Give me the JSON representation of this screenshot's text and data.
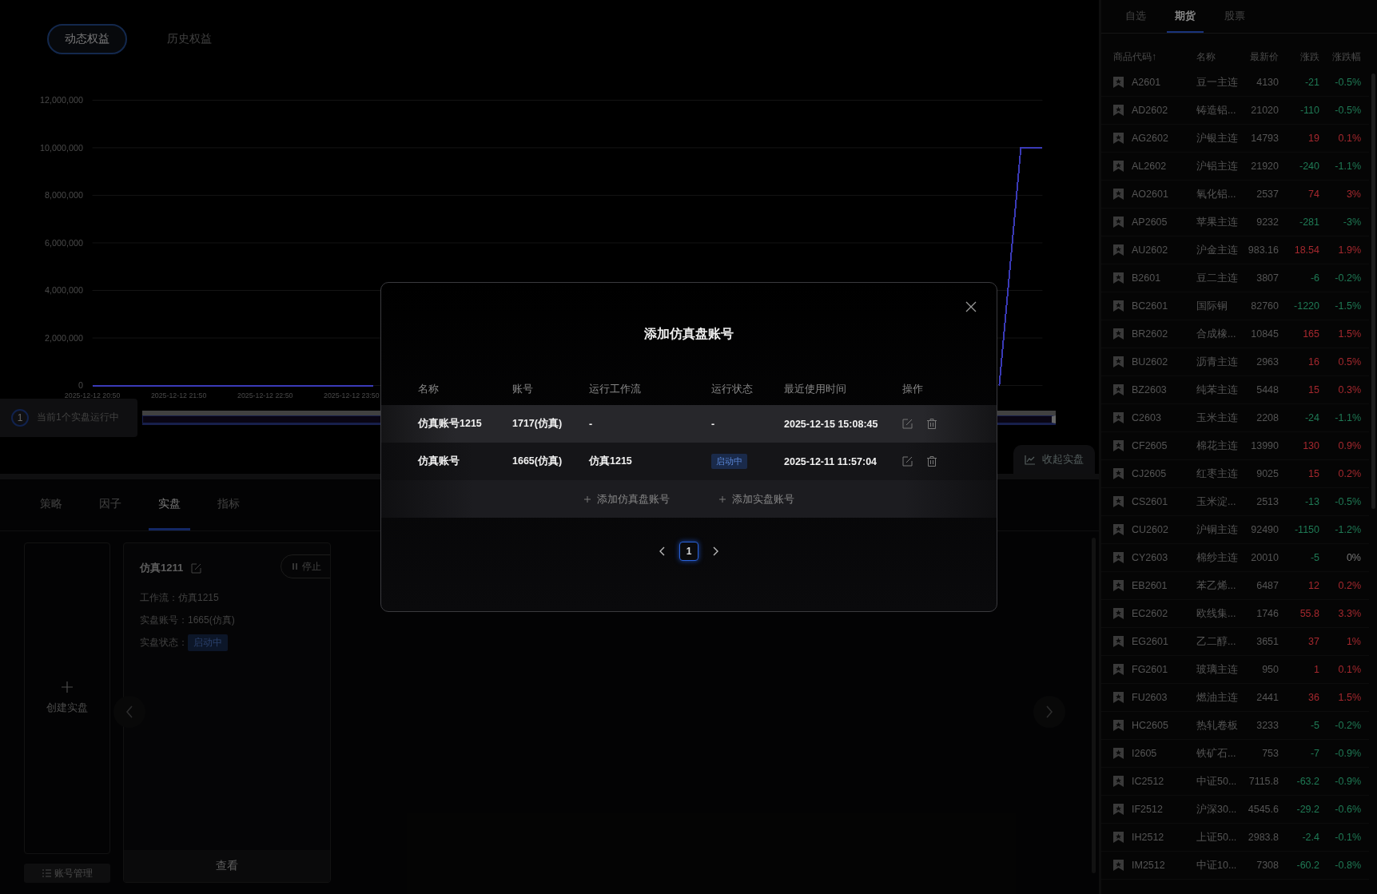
{
  "equity_tabs": [
    {
      "label": "动态权益",
      "selected": true
    },
    {
      "label": "历史权益",
      "selected": false
    }
  ],
  "chart": {
    "chart_data": {
      "type": "line",
      "grid": true,
      "categories": [
        "2025-12-12 20:50",
        null,
        null,
        null,
        "2025-12-12 21:50",
        null,
        null,
        null,
        "2025-12-12 22:50",
        null,
        null,
        null,
        "2025-12-12 23:50",
        null,
        null,
        null,
        null,
        null,
        null,
        null,
        null,
        null,
        null,
        null,
        null,
        null,
        null,
        null,
        null,
        null,
        null,
        null,
        null,
        null,
        null,
        null,
        null,
        null,
        null,
        null,
        null,
        null,
        null,
        null,
        null
      ],
      "series": [
        {
          "color": "#3a3ab8",
          "values": [
            0,
            0,
            0,
            0,
            0,
            0,
            0,
            0,
            0,
            0,
            0,
            0,
            0,
            0,
            null,
            null,
            null,
            null,
            null,
            null,
            null,
            null,
            null,
            null,
            null,
            null,
            null,
            null,
            null,
            null,
            null,
            null,
            null,
            null,
            null,
            null,
            null,
            null,
            null,
            null,
            null,
            null,
            0,
            10000000,
            10000000
          ]
        }
      ],
      "ylim": [
        0,
        12000000
      ],
      "yticks": [
        {
          "value": 0,
          "label": "0"
        },
        {
          "value": 2000000,
          "label": "2,000,000"
        },
        {
          "value": 4000000,
          "label": "4,000,000"
        },
        {
          "value": 6000000,
          "label": "6,000,000"
        },
        {
          "value": 8000000,
          "label": "8,000,000"
        },
        {
          "value": 10000000,
          "label": "10,000,000"
        },
        {
          "value": 12000000,
          "label": "12,000,000"
        }
      ]
    }
  },
  "running_notice": {
    "count": "1",
    "text": "当前1个实盘运行中"
  },
  "zoom_slider": {
    "level": 1
  },
  "collapse_button": "收起实盘",
  "section_tabs": [
    {
      "label": "策略",
      "selected": false
    },
    {
      "label": "因子",
      "selected": false
    },
    {
      "label": "实盘",
      "selected": true
    },
    {
      "label": "指标",
      "selected": false
    }
  ],
  "create_card": {
    "label": "创建实盘"
  },
  "account_manage_button": "账号管理",
  "live_card": {
    "title": "仿真1211",
    "stop_button": "停止",
    "fields": [
      {
        "label": "工作流：",
        "value": "仿真1215",
        "kind": "text"
      },
      {
        "label": "实盘账号：",
        "value": "1665(仿真)",
        "kind": "text"
      },
      {
        "label": "实盘状态：",
        "value": "启动中",
        "kind": "tag"
      }
    ],
    "footer_button": "查看"
  },
  "market": {
    "tabs": [
      {
        "label": "自选",
        "selected": false
      },
      {
        "label": "期货",
        "selected": true
      },
      {
        "label": "股票",
        "selected": false
      }
    ],
    "columns": [
      "商品代码↑",
      "名称",
      "最新价",
      "涨跌",
      "涨跌幅"
    ],
    "rows": [
      {
        "code": "A2601",
        "name": "豆一主连",
        "price": "4130",
        "change": {
          "text": "-21",
          "color": "#1f7a55"
        },
        "pct": {
          "text": "-0.5%",
          "color": "#1f7a55"
        }
      },
      {
        "code": "AD2602",
        "name": "铸造铝...",
        "price": "21020",
        "change": {
          "text": "-110",
          "color": "#1f7a55"
        },
        "pct": {
          "text": "-0.5%",
          "color": "#1f7a55"
        }
      },
      {
        "code": "AG2602",
        "name": "沪银主连",
        "price": "14793",
        "change": {
          "text": "19",
          "color": "#a5282e"
        },
        "pct": {
          "text": "0.1%",
          "color": "#a5282e"
        }
      },
      {
        "code": "AL2602",
        "name": "沪铝主连",
        "price": "21920",
        "change": {
          "text": "-240",
          "color": "#1f7a55"
        },
        "pct": {
          "text": "-1.1%",
          "color": "#1f7a55"
        }
      },
      {
        "code": "AO2601",
        "name": "氧化铝...",
        "price": "2537",
        "change": {
          "text": "74",
          "color": "#a5282e"
        },
        "pct": {
          "text": "3%",
          "color": "#a5282e"
        }
      },
      {
        "code": "AP2605",
        "name": "苹果主连",
        "price": "9232",
        "change": {
          "text": "-281",
          "color": "#1f7a55"
        },
        "pct": {
          "text": "-3%",
          "color": "#1f7a55"
        }
      },
      {
        "code": "AU2602",
        "name": "沪金主连",
        "price": "983.16",
        "change": {
          "text": "18.54",
          "color": "#a5282e"
        },
        "pct": {
          "text": "1.9%",
          "color": "#a5282e"
        }
      },
      {
        "code": "B2601",
        "name": "豆二主连",
        "price": "3807",
        "change": {
          "text": "-6",
          "color": "#1f7a55"
        },
        "pct": {
          "text": "-0.2%",
          "color": "#1f7a55"
        }
      },
      {
        "code": "BC2601",
        "name": "国际铜",
        "price": "82760",
        "change": {
          "text": "-1220",
          "color": "#1f7a55"
        },
        "pct": {
          "text": "-1.5%",
          "color": "#1f7a55"
        }
      },
      {
        "code": "BR2602",
        "name": "合成橡...",
        "price": "10845",
        "change": {
          "text": "165",
          "color": "#a5282e"
        },
        "pct": {
          "text": "1.5%",
          "color": "#a5282e"
        }
      },
      {
        "code": "BU2602",
        "name": "沥青主连",
        "price": "2963",
        "change": {
          "text": "16",
          "color": "#a5282e"
        },
        "pct": {
          "text": "0.5%",
          "color": "#a5282e"
        }
      },
      {
        "code": "BZ2603",
        "name": "纯苯主连",
        "price": "5448",
        "change": {
          "text": "15",
          "color": "#a5282e"
        },
        "pct": {
          "text": "0.3%",
          "color": "#a5282e"
        }
      },
      {
        "code": "C2603",
        "name": "玉米主连",
        "price": "2208",
        "change": {
          "text": "-24",
          "color": "#1f7a55"
        },
        "pct": {
          "text": "-1.1%",
          "color": "#1f7a55"
        }
      },
      {
        "code": "CF2605",
        "name": "棉花主连",
        "price": "13990",
        "change": {
          "text": "130",
          "color": "#a5282e"
        },
        "pct": {
          "text": "0.9%",
          "color": "#a5282e"
        }
      },
      {
        "code": "CJ2605",
        "name": "红枣主连",
        "price": "9025",
        "change": {
          "text": "15",
          "color": "#a5282e"
        },
        "pct": {
          "text": "0.2%",
          "color": "#a5282e"
        }
      },
      {
        "code": "CS2601",
        "name": "玉米淀...",
        "price": "2513",
        "change": {
          "text": "-13",
          "color": "#1f7a55"
        },
        "pct": {
          "text": "-0.5%",
          "color": "#1f7a55"
        }
      },
      {
        "code": "CU2602",
        "name": "沪铜主连",
        "price": "92490",
        "change": {
          "text": "-1150",
          "color": "#1f7a55"
        },
        "pct": {
          "text": "-1.2%",
          "color": "#1f7a55"
        }
      },
      {
        "code": "CY2603",
        "name": "棉纱主连",
        "price": "20010",
        "change": {
          "text": "-5",
          "color": "#1f7a55"
        },
        "pct": {
          "text": "0%",
          "color": "#777777"
        }
      },
      {
        "code": "EB2601",
        "name": "苯乙烯...",
        "price": "6487",
        "change": {
          "text": "12",
          "color": "#a5282e"
        },
        "pct": {
          "text": "0.2%",
          "color": "#a5282e"
        }
      },
      {
        "code": "EC2602",
        "name": "欧线集...",
        "price": "1746",
        "change": {
          "text": "55.8",
          "color": "#a5282e"
        },
        "pct": {
          "text": "3.3%",
          "color": "#a5282e"
        }
      },
      {
        "code": "EG2601",
        "name": "乙二醇...",
        "price": "3651",
        "change": {
          "text": "37",
          "color": "#a5282e"
        },
        "pct": {
          "text": "1%",
          "color": "#a5282e"
        }
      },
      {
        "code": "FG2601",
        "name": "玻璃主连",
        "price": "950",
        "change": {
          "text": "1",
          "color": "#a5282e"
        },
        "pct": {
          "text": "0.1%",
          "color": "#a5282e"
        }
      },
      {
        "code": "FU2603",
        "name": "燃油主连",
        "price": "2441",
        "change": {
          "text": "36",
          "color": "#a5282e"
        },
        "pct": {
          "text": "1.5%",
          "color": "#a5282e"
        }
      },
      {
        "code": "HC2605",
        "name": "热轧卷板",
        "price": "3233",
        "change": {
          "text": "-5",
          "color": "#1f7a55"
        },
        "pct": {
          "text": "-0.2%",
          "color": "#1f7a55"
        }
      },
      {
        "code": "I2605",
        "name": "铁矿石...",
        "price": "753",
        "change": {
          "text": "-7",
          "color": "#1f7a55"
        },
        "pct": {
          "text": "-0.9%",
          "color": "#1f7a55"
        }
      },
      {
        "code": "IC2512",
        "name": "中证50...",
        "price": "7115.8",
        "change": {
          "text": "-63.2",
          "color": "#1f7a55"
        },
        "pct": {
          "text": "-0.9%",
          "color": "#1f7a55"
        }
      },
      {
        "code": "IF2512",
        "name": "沪深30...",
        "price": "4545.6",
        "change": {
          "text": "-29.2",
          "color": "#1f7a55"
        },
        "pct": {
          "text": "-0.6%",
          "color": "#1f7a55"
        }
      },
      {
        "code": "IH2512",
        "name": "上证50...",
        "price": "2983.8",
        "change": {
          "text": "-2.4",
          "color": "#1f7a55"
        },
        "pct": {
          "text": "-0.1%",
          "color": "#1f7a55"
        }
      },
      {
        "code": "IM2512",
        "name": "中证10...",
        "price": "7308",
        "change": {
          "text": "-60.2",
          "color": "#1f7a55"
        },
        "pct": {
          "text": "-0.8%",
          "color": "#1f7a55"
        }
      }
    ]
  },
  "modal": {
    "title": "添加仿真盘账号",
    "columns": [
      "名称",
      "账号",
      "运行工作流",
      "运行状态",
      "最近使用时间",
      "操作"
    ],
    "rows": [
      {
        "name": "仿真账号1215",
        "account": "1717(仿真)",
        "workflow": "-",
        "status": {
          "text": "-",
          "kind": "text"
        },
        "last_used": "2025-12-15 15:08:45",
        "highlighted": true
      },
      {
        "name": "仿真账号",
        "account": "1665(仿真)",
        "workflow": "仿真1215",
        "status": {
          "text": "启动中",
          "kind": "tag"
        },
        "last_used": "2025-12-11 11:57:04",
        "highlighted": false
      }
    ],
    "add_links": [
      "添加仿真盘账号",
      "添加实盘账号"
    ],
    "pages": [
      {
        "label": "1",
        "selected": true
      }
    ]
  }
}
